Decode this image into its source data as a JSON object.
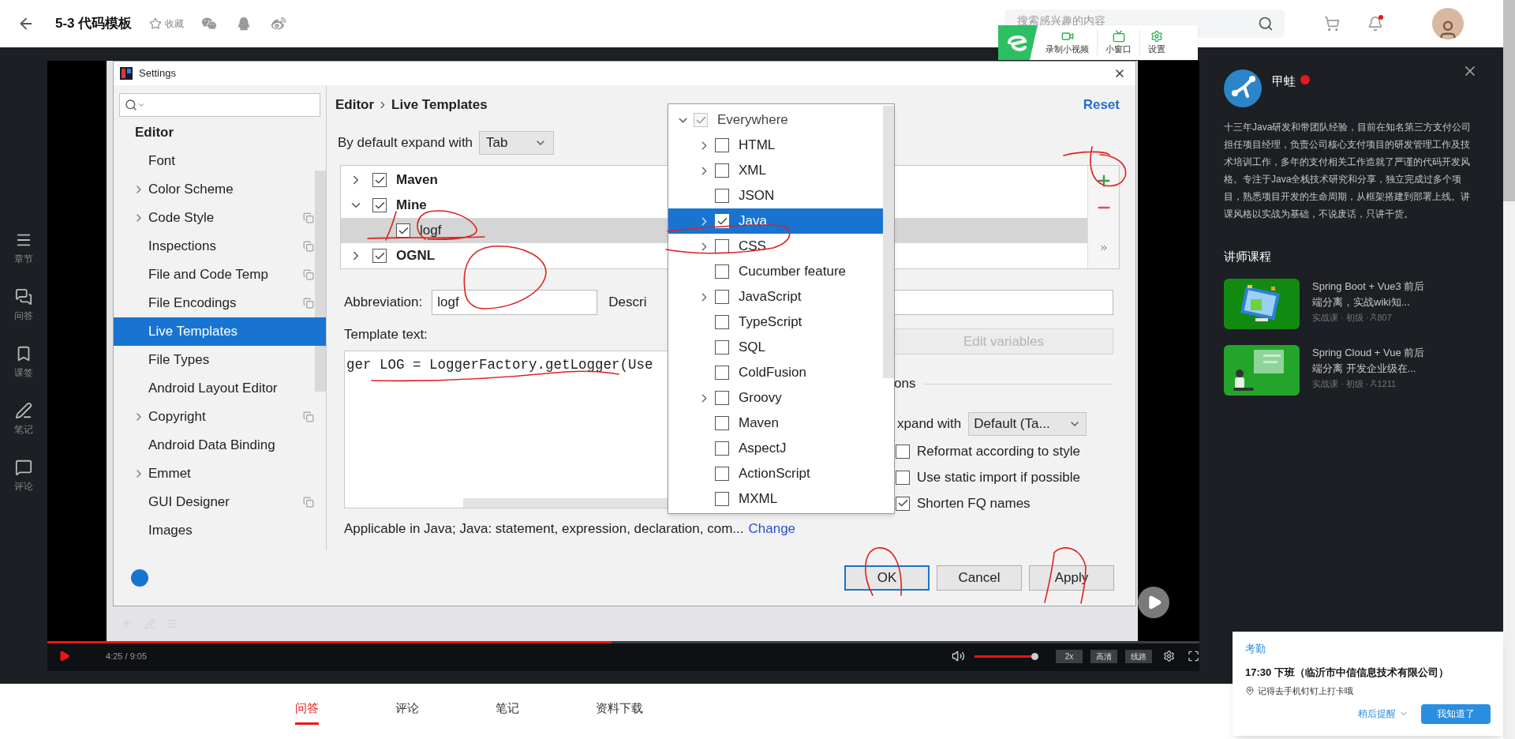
{
  "top_bar": {
    "title": "5-3 代码模板",
    "favorite": "收藏",
    "search": {
      "placeholder": "搜索感兴趣的内容"
    },
    "has_unread": true
  },
  "recorder_widget": {
    "buttons": [
      {
        "label": "录制小视频",
        "kind": "record"
      },
      {
        "label": "小窗口",
        "kind": "window"
      },
      {
        "label": "设置",
        "kind": "settings"
      }
    ]
  },
  "side_nav": [
    {
      "label": "章节",
      "kind": "chapters"
    },
    {
      "label": "问答",
      "kind": "qa"
    },
    {
      "label": "课签",
      "kind": "bookmark"
    },
    {
      "label": "笔记",
      "kind": "notes"
    },
    {
      "label": "评论",
      "kind": "comments"
    }
  ],
  "settings_dialog": {
    "title": "Settings",
    "nav": [
      {
        "label": "Editor",
        "kind": "group",
        "expandable": false,
        "shared": false,
        "selected": false
      },
      {
        "label": "Font",
        "kind": "item",
        "expandable": false,
        "shared": false,
        "selected": false
      },
      {
        "label": "Color Scheme",
        "kind": "item",
        "expandable": true,
        "shared": false,
        "selected": false
      },
      {
        "label": "Code Style",
        "kind": "item",
        "expandable": true,
        "shared": true,
        "selected": false
      },
      {
        "label": "Inspections",
        "kind": "item",
        "expandable": false,
        "shared": true,
        "selected": false
      },
      {
        "label": "File and Code Temp",
        "kind": "item",
        "expandable": false,
        "shared": true,
        "selected": false
      },
      {
        "label": "File Encodings",
        "kind": "item",
        "expandable": false,
        "shared": true,
        "selected": false
      },
      {
        "label": "Live Templates",
        "kind": "item",
        "expandable": false,
        "shared": false,
        "selected": true
      },
      {
        "label": "File Types",
        "kind": "item",
        "expandable": false,
        "shared": false,
        "selected": false
      },
      {
        "label": "Android Layout Editor",
        "kind": "item",
        "expandable": false,
        "shared": false,
        "selected": false
      },
      {
        "label": "Copyright",
        "kind": "item",
        "expandable": true,
        "shared": true,
        "selected": false
      },
      {
        "label": "Android Data Binding",
        "kind": "item",
        "expandable": false,
        "shared": false,
        "selected": false
      },
      {
        "label": "Emmet",
        "kind": "item",
        "expandable": true,
        "shared": false,
        "selected": false
      },
      {
        "label": "GUI Designer",
        "kind": "item",
        "expandable": false,
        "shared": true,
        "selected": false
      },
      {
        "label": "Images",
        "kind": "item",
        "expandable": false,
        "shared": false,
        "selected": false
      }
    ],
    "breadcrumb": [
      "Editor",
      "Live Templates"
    ],
    "reset": "Reset",
    "expand_with": {
      "label": "By default expand with",
      "value": "Tab"
    },
    "template_groups": [
      {
        "name": "Maven",
        "checked": true,
        "expanded": false,
        "selected": false
      },
      {
        "name": "Mine",
        "checked": true,
        "expanded": true,
        "selected": false,
        "children": [
          {
            "name": "logf",
            "checked": true,
            "selected": true
          }
        ]
      },
      {
        "name": "OGNL",
        "checked": true,
        "expanded": false,
        "selected": false
      }
    ],
    "abbreviation": {
      "label": "Abbreviation:",
      "value": "logf"
    },
    "description_label": "Descri",
    "template_text": {
      "label": "Template text:",
      "value": "ger LOG = LoggerFactory.getLogger(Use"
    },
    "edit_variables": {
      "label": "Edit variables",
      "disabled": true
    },
    "options_label": "ons",
    "option_expand": {
      "label": "xpand with",
      "value": "Default (Ta..."
    },
    "options": [
      {
        "label": "Reformat according to style",
        "checked": false
      },
      {
        "label": "Use static import if possible",
        "checked": false
      },
      {
        "label": "Shorten FQ names",
        "checked": true
      }
    ],
    "applicable": "Applicable in Java; Java: statement, expression, declaration, com...",
    "change_link": "Change",
    "buttons": [
      {
        "label": "OK",
        "default": true
      },
      {
        "label": "Cancel",
        "default": false
      },
      {
        "label": "Apply",
        "default": false
      }
    ],
    "context_popup": [
      {
        "label": "Everywhere",
        "checked": true,
        "disabled": true,
        "expandable": true,
        "expanded": true,
        "selected": false,
        "children": [
          {
            "label": "HTML",
            "checked": false,
            "expandable": true,
            "selected": false
          },
          {
            "label": "XML",
            "checked": false,
            "expandable": true,
            "selected": false
          },
          {
            "label": "JSON",
            "checked": false,
            "expandable": false,
            "selected": false
          },
          {
            "label": "Java",
            "checked": true,
            "expandable": true,
            "selected": true
          },
          {
            "label": "CSS",
            "checked": false,
            "expandable": true,
            "selected": false
          },
          {
            "label": "Cucumber feature",
            "checked": false,
            "expandable": false,
            "selected": false
          },
          {
            "label": "JavaScript",
            "checked": false,
            "expandable": true,
            "selected": false
          },
          {
            "label": "TypeScript",
            "checked": false,
            "expandable": false,
            "selected": false
          },
          {
            "label": "SQL",
            "checked": false,
            "expandable": false,
            "selected": false
          },
          {
            "label": "ColdFusion",
            "checked": false,
            "expandable": false,
            "selected": false
          },
          {
            "label": "Groovy",
            "checked": false,
            "expandable": true,
            "selected": false
          },
          {
            "label": "Maven",
            "checked": false,
            "expandable": false,
            "selected": false
          },
          {
            "label": "AspectJ",
            "checked": false,
            "expandable": false,
            "selected": false
          },
          {
            "label": "ActionScript",
            "checked": false,
            "expandable": false,
            "selected": false
          },
          {
            "label": "MXML",
            "checked": false,
            "expandable": false,
            "selected": false
          }
        ]
      }
    ]
  },
  "player": {
    "time": "4:25 / 9:05",
    "progress": {
      "level": 0.49
    },
    "volume": {
      "level": 1
    },
    "speed": "2x",
    "quality": "高清",
    "route": "线路"
  },
  "tabs": [
    {
      "label": "问答",
      "selected": true
    },
    {
      "label": "评论",
      "selected": false
    },
    {
      "label": "笔记",
      "selected": false
    },
    {
      "label": "资料下载",
      "selected": false
    }
  ],
  "teacher": {
    "name": "甲蛙",
    "bio": "十三年Java研发和带团队经验，目前在知名第三方支付公司担任项目经理，负责公司核心支付项目的研发管理工作及技术培训工作，多年的支付相关工作造就了严谨的代码开发风格。专注于Java全栈技术研究和分享，独立完成过多个项目，熟悉项目开发的生命周期，从框架搭建到部署上线。讲课风格以实战为基础，不说废话，只讲干货。",
    "courses_heading": "讲师课程",
    "courses": [
      {
        "title": "Spring Boot + Vue3 前后端分离，实战wiki知...",
        "meta": "实战课 · 初级 · ",
        "students": "807",
        "kind": "picture"
      },
      {
        "title": "Spring Cloud + Vue 前后端分离 开发企业级在...",
        "meta": "实战课 · 初级 · ",
        "students": "1211",
        "kind": "picture"
      }
    ]
  },
  "notification": {
    "title": "考勤",
    "message": "17:30 下班（临沂市中信信息技术有限公司）",
    "location": "记得去手机钉钉上打卡哦",
    "later": "稍后提醒",
    "confirm": "我知道了"
  }
}
